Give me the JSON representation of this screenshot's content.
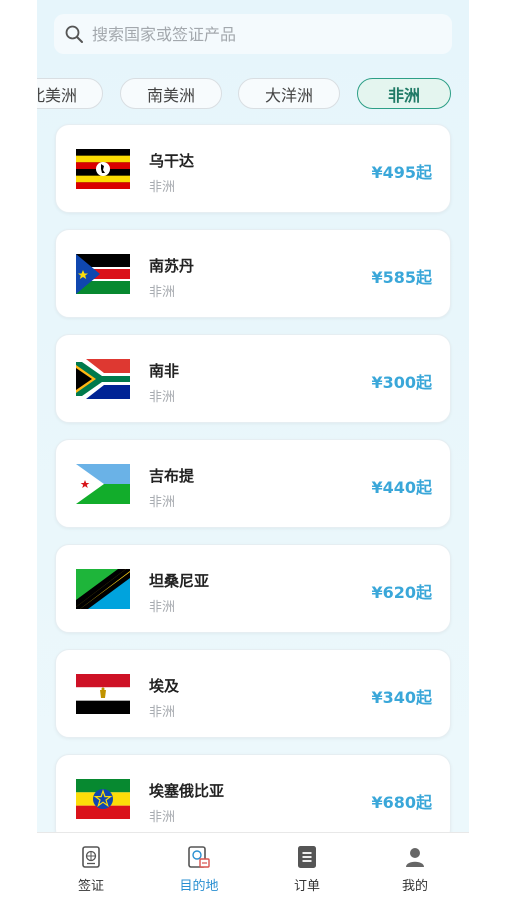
{
  "search": {
    "placeholder": "搜索国家或签证产品"
  },
  "tabs": [
    {
      "label": "北美洲"
    },
    {
      "label": "南美洲"
    },
    {
      "label": "大洋洲"
    },
    {
      "label": "非洲",
      "active": true
    }
  ],
  "countries": [
    {
      "name": "乌干达",
      "region": "非洲",
      "price": "¥495起",
      "flag": "uganda-flag-icon"
    },
    {
      "name": "南苏丹",
      "region": "非洲",
      "price": "¥585起",
      "flag": "south-sudan-flag-icon"
    },
    {
      "name": "南非",
      "region": "非洲",
      "price": "¥300起",
      "flag": "south-africa-flag-icon"
    },
    {
      "name": "吉布提",
      "region": "非洲",
      "price": "¥440起",
      "flag": "djibouti-flag-icon"
    },
    {
      "name": "坦桑尼亚",
      "region": "非洲",
      "price": "¥620起",
      "flag": "tanzania-flag-icon"
    },
    {
      "name": "埃及",
      "region": "非洲",
      "price": "¥340起",
      "flag": "egypt-flag-icon"
    },
    {
      "name": "埃塞俄比亚",
      "region": "非洲",
      "price": "¥680起",
      "flag": "ethiopia-flag-icon"
    }
  ],
  "nav": [
    {
      "label": "签证",
      "icon": "passport-icon"
    },
    {
      "label": "目的地",
      "icon": "destination-icon",
      "active": true
    },
    {
      "label": "订单",
      "icon": "order-list-icon"
    },
    {
      "label": "我的",
      "icon": "user-icon"
    }
  ],
  "colors": {
    "accent": "#3aa7d9",
    "active_tab": "#2d9f86",
    "nav_active": "#2a8fd1"
  }
}
